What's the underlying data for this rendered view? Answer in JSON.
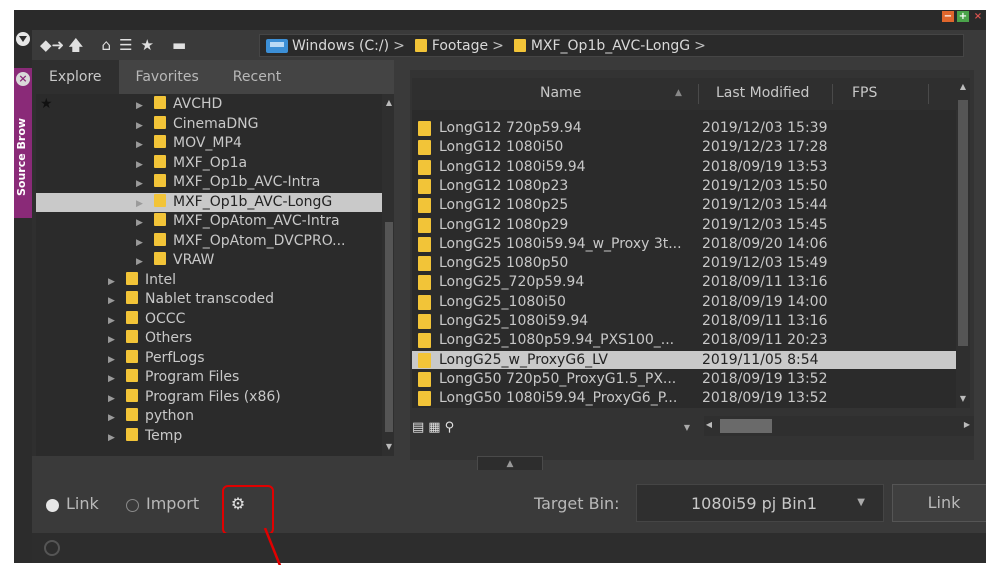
{
  "window": {
    "controls": [
      "−",
      "+",
      "×"
    ],
    "side_tab_label": "Source Brow"
  },
  "toolbar": {
    "icons": [
      "back-arrow-icon",
      "forward-arrow-icon",
      "up-arrow-icon",
      "home-icon",
      "list-tree-icon",
      "star-icon",
      "drive-toggle-icon"
    ],
    "breadcrumb": [
      "Windows (C:/)",
      "Footage",
      "MXF_Op1b_AVC-LongG"
    ],
    "separator": ">"
  },
  "left_pane": {
    "tabs": [
      "Explore",
      "Favorites",
      "Recent"
    ],
    "active_tab": "Explore",
    "tree_items": [
      {
        "label": "AVCHD",
        "level": 2
      },
      {
        "label": "CinemaDNG",
        "level": 2
      },
      {
        "label": "MOV_MP4",
        "level": 2
      },
      {
        "label": "MXF_Op1a",
        "level": 2
      },
      {
        "label": "MXF_Op1b_AVC-Intra",
        "level": 2
      },
      {
        "label": "MXF_Op1b_AVC-LongG",
        "level": 2,
        "selected": true
      },
      {
        "label": "MXF_OpAtom_AVC-Intra",
        "level": 2
      },
      {
        "label": "MXF_OpAtom_DVCPRO...",
        "level": 2
      },
      {
        "label": "VRAW",
        "level": 2
      },
      {
        "label": "Intel",
        "level": 1
      },
      {
        "label": "Nablet transcoded",
        "level": 1
      },
      {
        "label": "OCCC",
        "level": 1
      },
      {
        "label": "Others",
        "level": 1
      },
      {
        "label": "PerfLogs",
        "level": 1
      },
      {
        "label": "Program Files",
        "level": 1
      },
      {
        "label": "Program Files (x86)",
        "level": 1
      },
      {
        "label": "python",
        "level": 1
      },
      {
        "label": "Temp",
        "level": 1
      }
    ]
  },
  "file_list": {
    "columns": [
      "Name",
      "Last Modified",
      "FPS"
    ],
    "sort_indicator": "▲",
    "rows": [
      {
        "name": "LongG12 720p59.94",
        "modified": "2019/12/03 15:39"
      },
      {
        "name": "LongG12 1080i50",
        "modified": "2019/12/23 17:28"
      },
      {
        "name": "LongG12 1080i59.94",
        "modified": "2018/09/19 13:53"
      },
      {
        "name": "LongG12 1080p23",
        "modified": "2019/12/03 15:50"
      },
      {
        "name": "LongG12 1080p25",
        "modified": "2019/12/03 15:44"
      },
      {
        "name": "LongG12 1080p29",
        "modified": "2019/12/03 15:45"
      },
      {
        "name": "LongG25 1080i59.94_w_Proxy 3t...",
        "modified": "2018/09/20 14:06"
      },
      {
        "name": "LongG25 1080p50",
        "modified": "2019/12/03 15:49"
      },
      {
        "name": "LongG25_720p59.94",
        "modified": "2018/09/11 13:16"
      },
      {
        "name": "LongG25_1080i50",
        "modified": "2018/09/19 14:00"
      },
      {
        "name": "LongG25_1080i59.94",
        "modified": "2018/09/11 13:16"
      },
      {
        "name": "LongG25_1080p59.94_PXS100_...",
        "modified": "2018/09/11 20:23"
      },
      {
        "name": "LongG25_w_ProxyG6_LV",
        "modified": "2019/11/05 8:54",
        "selected": true
      },
      {
        "name": "LongG50 720p50_ProxyG1.5_PX...",
        "modified": "2018/09/19 13:52"
      },
      {
        "name": "LongG50 1080i59.94_ProxyG6_P...",
        "modified": "2018/09/19 13:52"
      }
    ]
  },
  "bottom": {
    "mode_options": [
      "Link",
      "Import"
    ],
    "selected_mode": "Link",
    "target_bin_label": "Target Bin:",
    "target_bin_value": "1080i59 pj Bin1",
    "action_button": "Link"
  },
  "colors": {
    "panel_bg": "#3a3a3a",
    "list_bg": "#2b2b2b",
    "selection": "#c9c9c9",
    "folder": "#f2c438",
    "side_tab": "#8a2a78",
    "annotation": "#e00000"
  }
}
